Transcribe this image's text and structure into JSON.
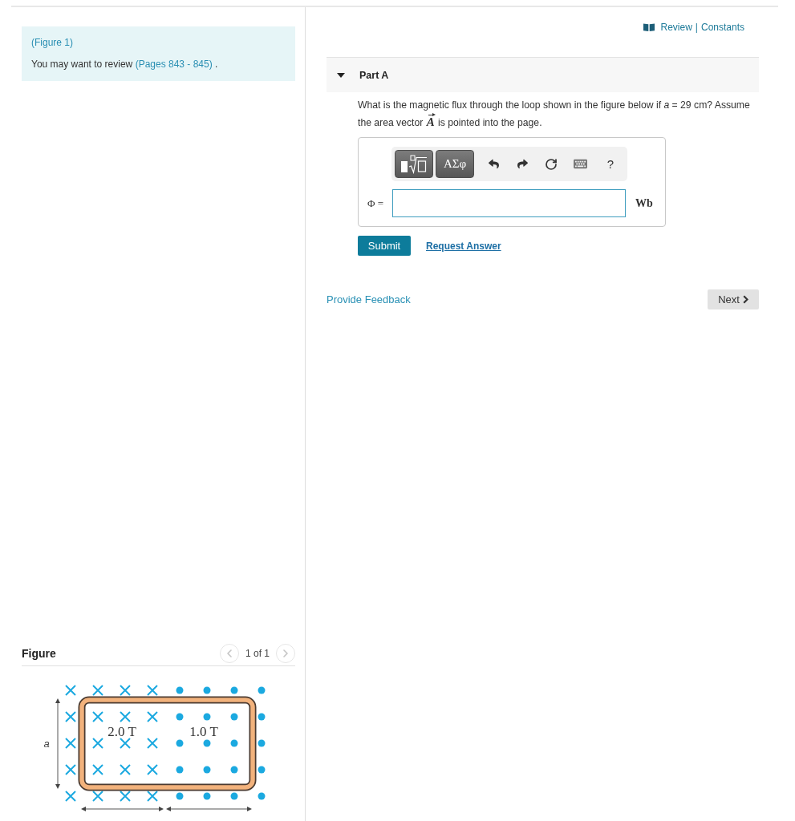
{
  "sidebar": {
    "figure_link": "(Figure 1)",
    "review_note": {
      "text": "You may want to review",
      "link": "(Pages 843 - 845)",
      "end": "."
    }
  },
  "figure_panel": {
    "title": "Figure",
    "pager": {
      "label": "1 of 1",
      "prev": {
        "disabled": true
      },
      "next": {
        "disabled": true
      }
    },
    "diagram": {
      "side_label": "a",
      "regions": [
        {
          "kind": "into_page",
          "field": "2.0 T"
        },
        {
          "kind": "out_of_page",
          "field": "1.0 T"
        }
      ]
    }
  },
  "header": {
    "review_link": "Review",
    "separator": "|",
    "constants_link": "Constants"
  },
  "part": {
    "title": "Part A",
    "expanded": true,
    "question": {
      "before": "What is the magnetic flux through the loop shown in the figure below if *a* = 29 cm? Assume the area vector",
      "vector": "A",
      "after": "is pointed into the page."
    },
    "toolbar": [
      {
        "kind": "templates"
      },
      {
        "kind": "symbols",
        "label": "ΑΣφ"
      },
      {
        "kind": "undo"
      },
      {
        "kind": "redo"
      },
      {
        "kind": "reset"
      },
      {
        "kind": "keyboard"
      },
      {
        "kind": "help",
        "label": "?"
      }
    ],
    "answer": {
      "label": "Φ =",
      "unit": "Wb"
    },
    "actions": {
      "submit": "Submit",
      "request": "Request Answer"
    }
  },
  "footer": {
    "feedback_link": "Provide Feedback",
    "next_button": "Next"
  }
}
